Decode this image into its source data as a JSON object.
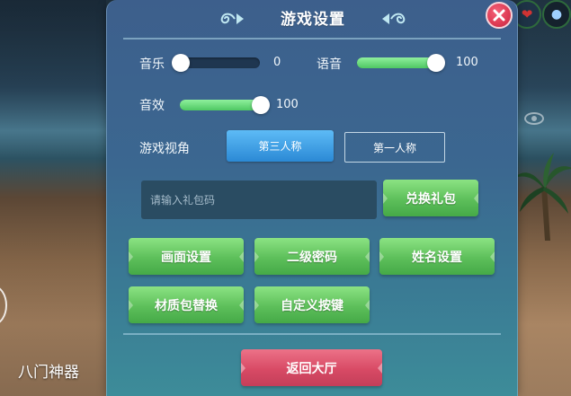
{
  "dialog": {
    "title": "游戏设置"
  },
  "sound": {
    "music": {
      "label": "音乐",
      "value": 0,
      "value_text": "0"
    },
    "voice": {
      "label": "语音",
      "value": 100,
      "value_text": "100"
    },
    "effects": {
      "label": "音效",
      "value": 100,
      "value_text": "100"
    }
  },
  "view": {
    "label": "游戏视角",
    "options": [
      "第三人称",
      "第一人称"
    ],
    "selected": "第三人称"
  },
  "gift": {
    "placeholder": "请输入礼包码",
    "redeem_label": "兑换礼包"
  },
  "buttons": {
    "graphics": "画面设置",
    "secondary_password": "二级密码",
    "name_settings": "姓名设置",
    "texture_pack": "材质包替换",
    "custom_keys": "自定义按键"
  },
  "return_label": "返回大厅",
  "watermark": "八门神器",
  "icons": {
    "close": "close-icon",
    "ornament": "ornament-icon",
    "heart": "heart-icon",
    "eye": "eye-icon"
  },
  "colors": {
    "panel_top": "#3d5f8c",
    "panel_bottom": "#3d8c99",
    "accent_green": "#5dbf5a",
    "accent_blue": "#2b89d5",
    "accent_red": "#d84a65",
    "slider_fill": "#4fc863"
  }
}
